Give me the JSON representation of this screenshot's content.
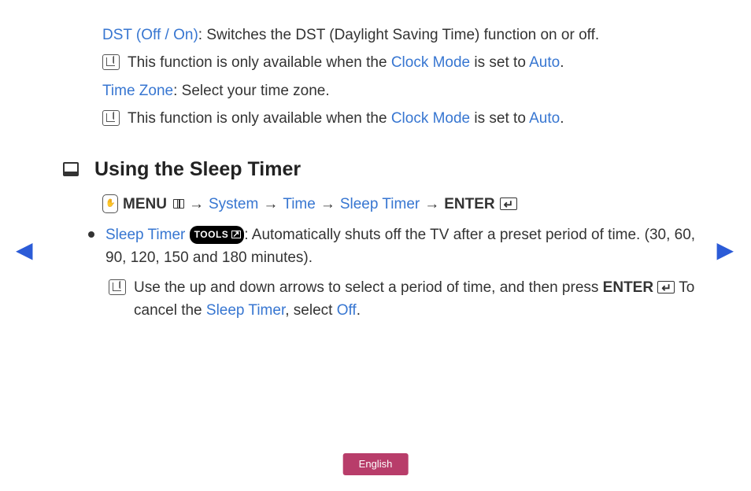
{
  "dst": {
    "label": "DST (Off / On)",
    "desc": ": Switches the DST (Daylight Saving Time) function on or off."
  },
  "note_prefix": "This function is only available when the ",
  "clock_mode": "Clock Mode",
  "note_mid": " is set to ",
  "auto": "Auto",
  "period": ".",
  "timezone": {
    "label": "Time Zone",
    "desc": ": Select your time zone."
  },
  "section": "Using the Sleep Timer",
  "path": {
    "menu": "MENU",
    "arrow": "→",
    "system": "System",
    "time": "Time",
    "sleep": "Sleep Timer",
    "enter": "ENTER"
  },
  "sleep": {
    "label": "Sleep Timer ",
    "tools": "TOOLS",
    "desc1": ": Automatically shuts off the TV after a preset period of time. (30, 60, 90, 120, 150 and 180 minutes).",
    "note_a": "Use the up and down arrows to select a period of time, and then press ",
    "enter": "ENTER",
    "note_b": " To cancel the ",
    "st": "Sleep Timer",
    "note_c": ", select ",
    "off": "Off",
    "note_d": "."
  },
  "nav": {
    "prev": "◀",
    "next": "▶"
  },
  "language": "English"
}
